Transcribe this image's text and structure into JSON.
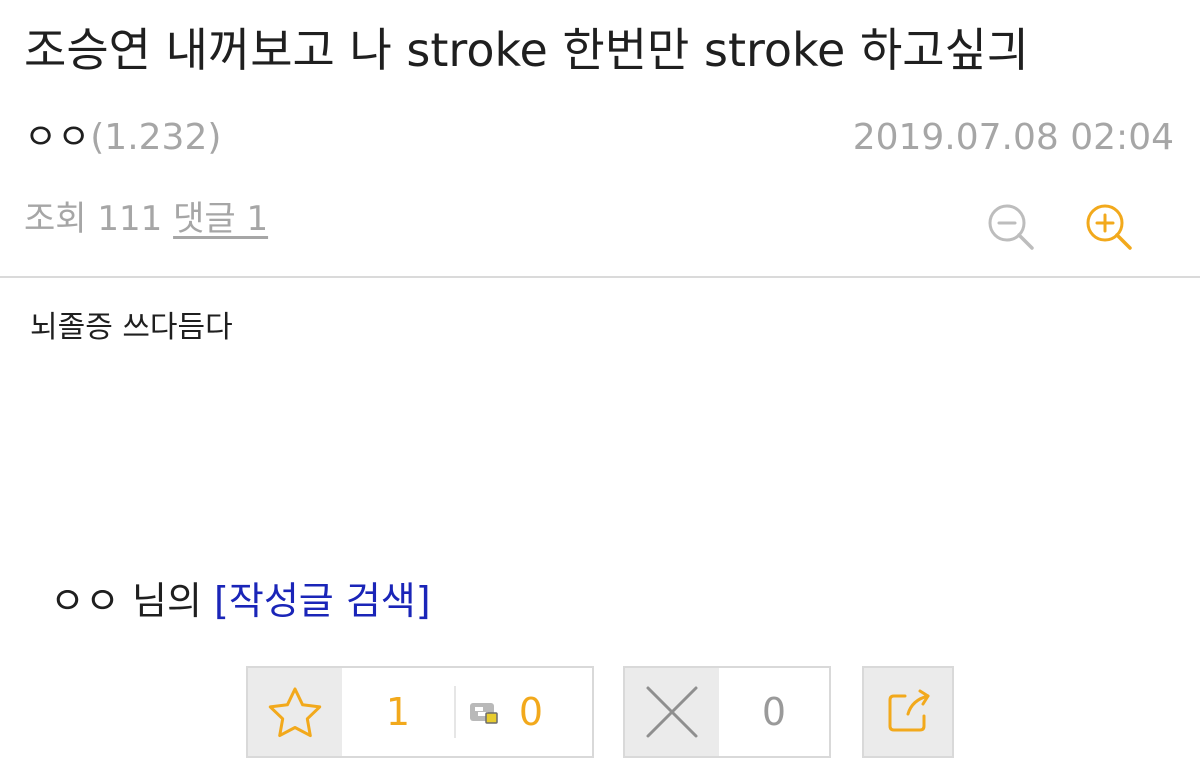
{
  "post": {
    "title": "조승연 내꺼보고 나 stroke 한번만 stroke 하고싶긔",
    "author": {
      "nickname": "ㅇㅇ",
      "points": "(1.232)"
    },
    "date": "2019.07.08 02:04",
    "views_label": "조회 111",
    "comments_link": "댓글 1",
    "body": "뇌졸증 쓰다듬다"
  },
  "writer": {
    "nickname": "ㅇㅇ",
    "suffix": "님의",
    "search_link": "[작성글 검색]"
  },
  "actions": {
    "upvote_count": "1",
    "fix_upvote_count": "0",
    "downvote_count": "0"
  },
  "icons": {
    "zoom_out": "zoom-out-icon",
    "zoom_in": "zoom-in-icon",
    "upvote": "star-icon",
    "fix_upvote": "fixed-upvote-icon",
    "downvote": "x-icon",
    "share": "share-icon"
  },
  "colors": {
    "accent": "#f2a91c",
    "link": "#1a25b8",
    "muted": "#a6a6a6"
  }
}
